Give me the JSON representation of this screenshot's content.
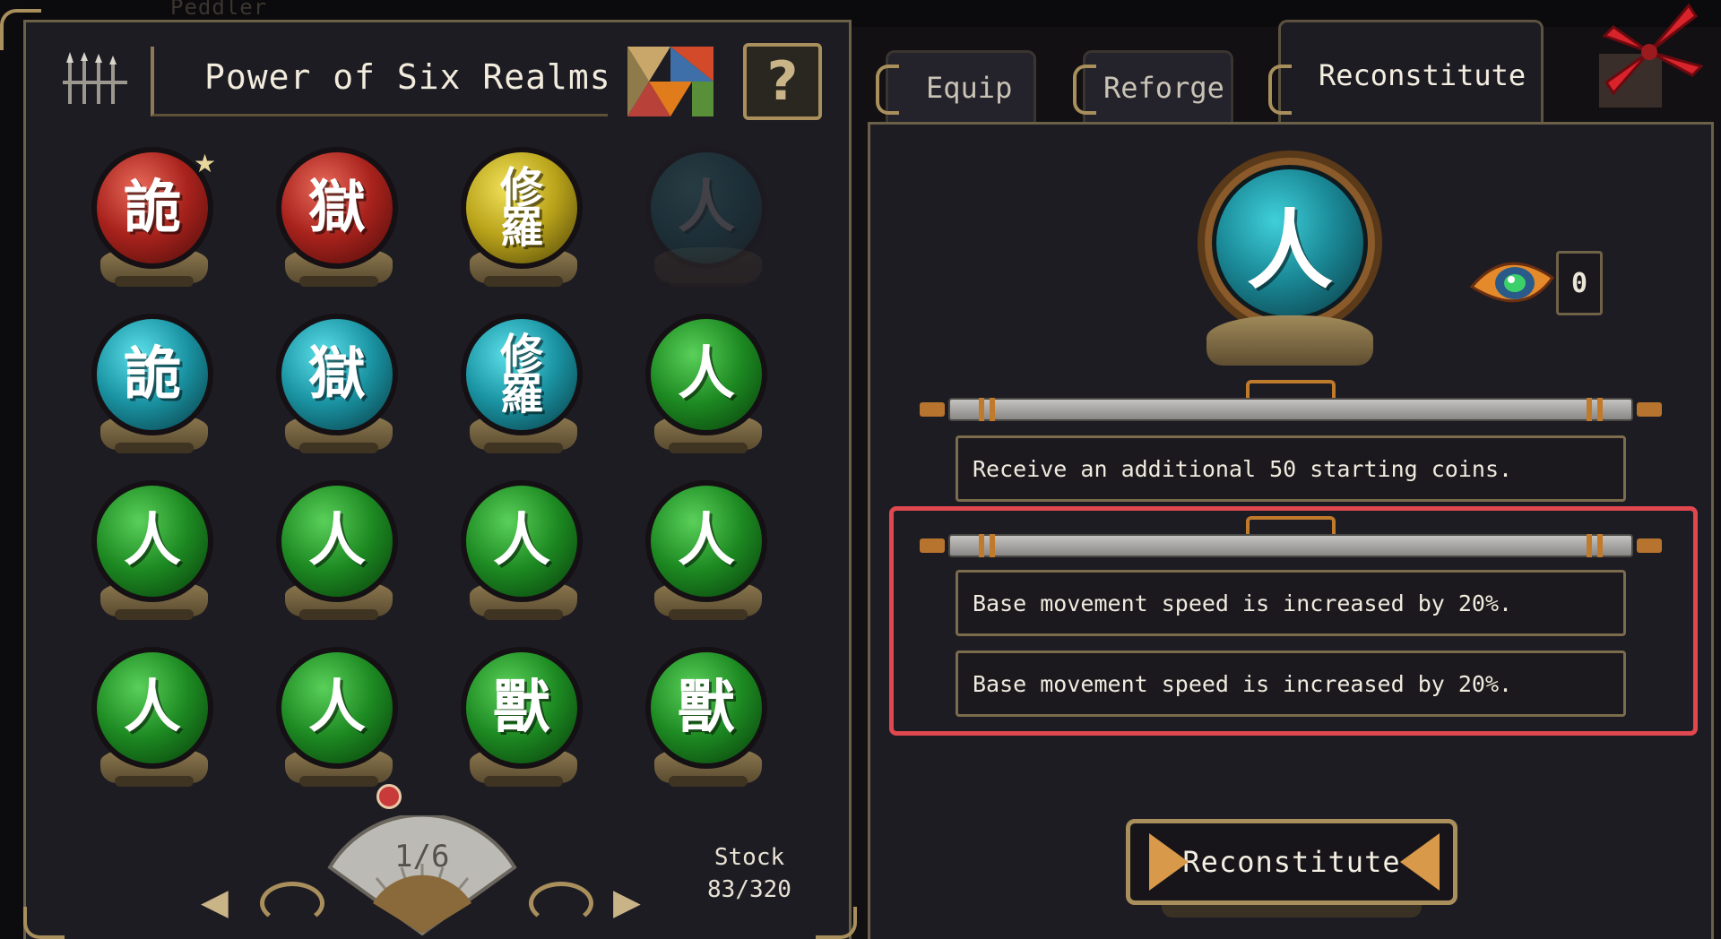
{
  "background": {
    "peddler_label": "Peddler"
  },
  "left_panel": {
    "title": "Power of Six Realms",
    "help_label": "?",
    "orbs": [
      {
        "char": "詭",
        "color": "red",
        "dim": false,
        "starred": true
      },
      {
        "char": "獄",
        "color": "red",
        "dim": false,
        "starred": false
      },
      {
        "char": "修羅",
        "color": "yellow",
        "dim": false,
        "starred": false
      },
      {
        "char": "人",
        "color": "teal",
        "dim": true,
        "starred": false
      },
      {
        "char": "詭",
        "color": "teal",
        "dim": false,
        "starred": false
      },
      {
        "char": "獄",
        "color": "teal",
        "dim": false,
        "starred": false
      },
      {
        "char": "修羅",
        "color": "teal",
        "dim": false,
        "starred": false
      },
      {
        "char": "人",
        "color": "green",
        "dim": false,
        "starred": false
      },
      {
        "char": "人",
        "color": "green",
        "dim": false,
        "starred": false
      },
      {
        "char": "人",
        "color": "green",
        "dim": false,
        "starred": false
      },
      {
        "char": "人",
        "color": "green",
        "dim": false,
        "starred": false
      },
      {
        "char": "人",
        "color": "green",
        "dim": false,
        "starred": false
      },
      {
        "char": "人",
        "color": "green",
        "dim": false,
        "starred": false
      },
      {
        "char": "人",
        "color": "green",
        "dim": false,
        "starred": false
      },
      {
        "char": "獸",
        "color": "green",
        "dim": false,
        "starred": false
      },
      {
        "char": "獸",
        "color": "green",
        "dim": false,
        "starred": false
      }
    ],
    "page_indicator": "1/6",
    "prev_label": "◀",
    "next_label": "▶",
    "stock_label": "Stock",
    "stock_value": "83/320"
  },
  "tabs": [
    {
      "label": "Equip",
      "active": false
    },
    {
      "label": "Reforge",
      "active": false
    },
    {
      "label": "Reconstitute",
      "active": true
    }
  ],
  "right_panel": {
    "selected_orb_char": "人",
    "eye_count": "0",
    "effects": [
      "Receive an additional 50 starting coins.",
      "Base movement speed is increased by 20%.",
      "Base movement speed is increased by 20%."
    ],
    "action_button": "Reconstitute"
  },
  "colors": {
    "red": "#c0322a",
    "yellow": "#c7b21c",
    "teal": "#1ea4b2",
    "green": "#1f9a24",
    "highlight": "#e0484f",
    "gold": "#a88f5c"
  }
}
